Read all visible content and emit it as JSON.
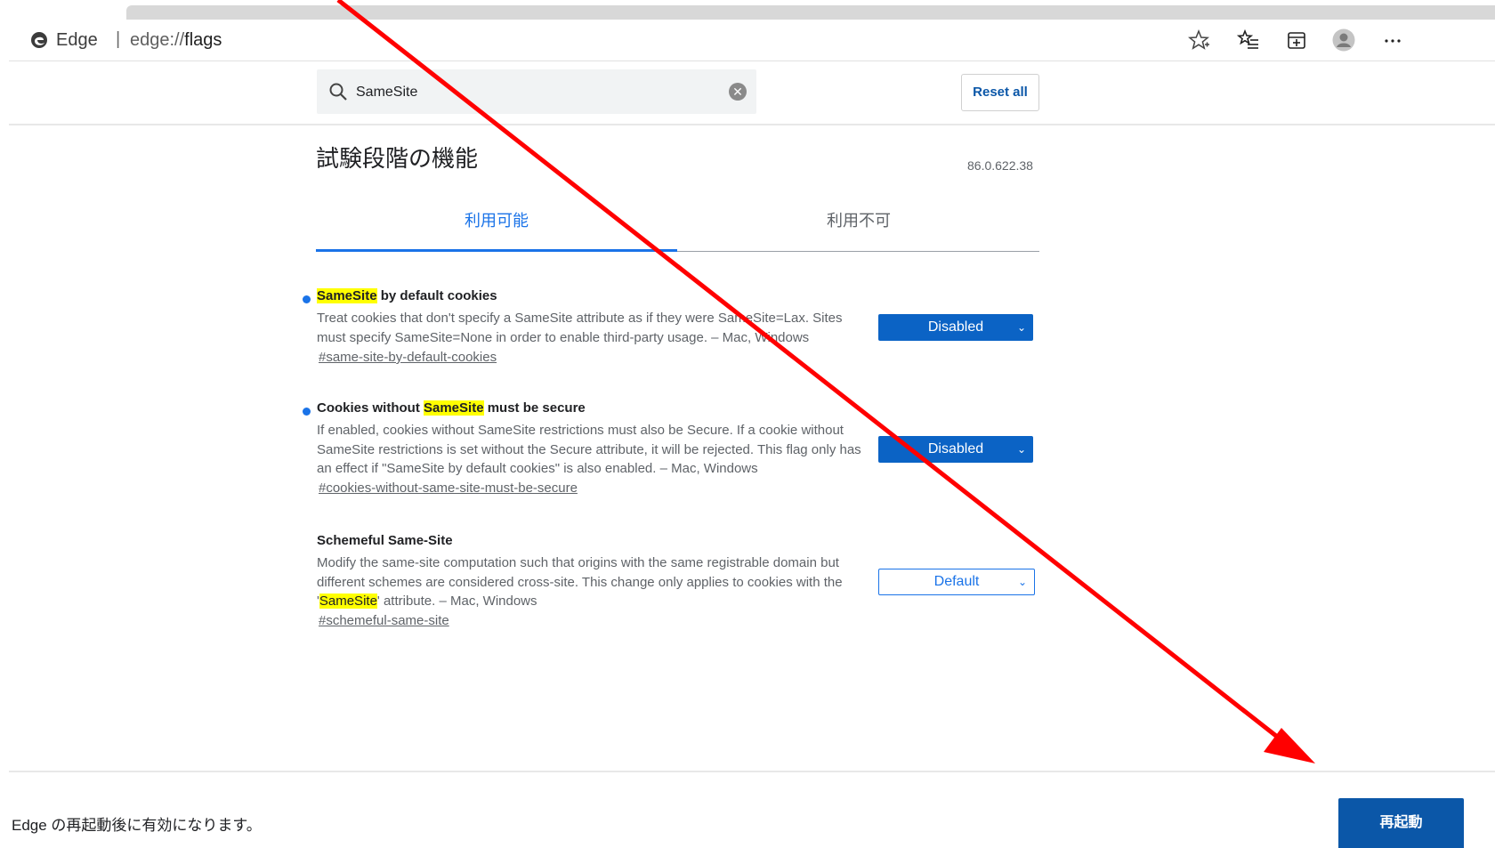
{
  "browser": {
    "brand": "Edge",
    "separator": "|",
    "url_prefix": "edge://",
    "url_host": "flags",
    "icons": [
      "favorite-star-icon",
      "favorites-list-icon",
      "collections-icon",
      "profile-avatar-icon",
      "more-menu-icon"
    ]
  },
  "header": {
    "search_value": "SameSite",
    "reset_label": "Reset all",
    "title": "試験段階の機能",
    "version": "86.0.622.38"
  },
  "tabs": [
    {
      "label": "利用可能",
      "active": true
    },
    {
      "label": "利用不可",
      "active": false
    }
  ],
  "experiments": [
    {
      "title_pre": "",
      "title_hl": "SameSite",
      "title_post": " by default cookies",
      "desc_1": "Treat cookies that don't specify a SameSite attribute as if they were SameSite=Lax. Sites must specify SameSite=None in order to enable third-party usage. – Mac, Windows",
      "link": "#same-site-by-default-cookies",
      "value": "Disabled",
      "modified": true
    },
    {
      "title_pre": "Cookies without ",
      "title_hl": "SameSite",
      "title_post": " must be secure",
      "desc_1": "If enabled, cookies without SameSite restrictions must also be Secure. If a cookie without SameSite restrictions is set without the Secure attribute, it will be rejected. This flag only has an effect if \"SameSite by default cookies\" is also enabled. – Mac, Windows",
      "link": "#cookies-without-same-site-must-be-secure",
      "value": "Disabled",
      "modified": true
    },
    {
      "title_pre": "Schemeful Same-Site",
      "title_hl": "",
      "title_post": "",
      "desc_1": "Modify the same-site computation such that origins with the same registrable domain but different schemes are considered cross-site. This change only applies to cookies with the '",
      "desc_hl": "SameSite",
      "desc_2": "' attribute. – Mac, Windows",
      "link": "#schemeful-same-site",
      "value": "Default",
      "modified": false
    }
  ],
  "footer": {
    "message": "Edge の再起動後に有効になります。",
    "restart_label": "再起動"
  },
  "colors": {
    "accent": "#1a73e8",
    "select_blue": "#0b63c5",
    "restart_blue": "#0b57a8",
    "highlight": "#ffff00",
    "annotation_arrow": "#ff0000"
  }
}
